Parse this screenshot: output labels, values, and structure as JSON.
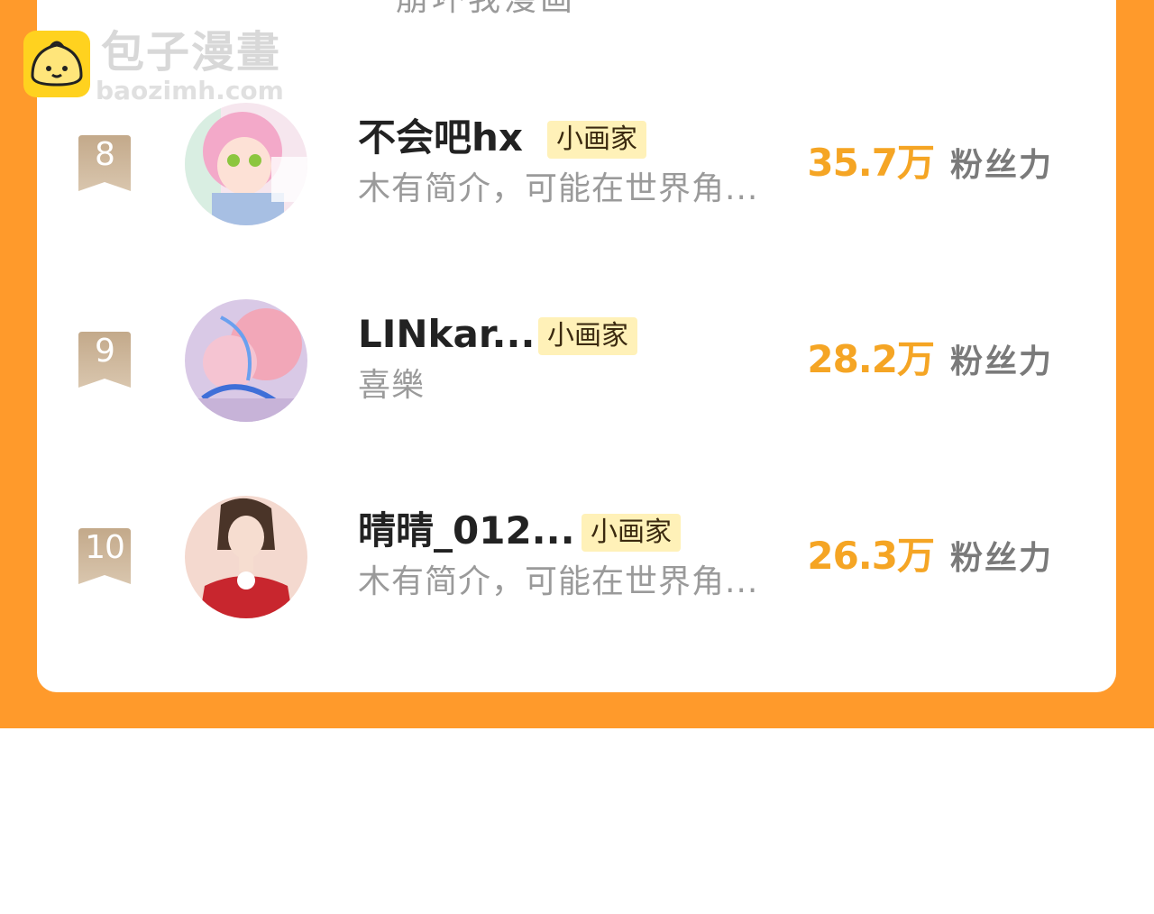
{
  "watermark": {
    "title": "包子漫畫",
    "url": "baozimh.com"
  },
  "top_partial_text": "崩坏我漫画",
  "ranking": [
    {
      "rank": "8",
      "name": "不会吧hx",
      "tag": "小画家",
      "bio": "木有简介，可能在世界角...",
      "fans_value": "35.7万",
      "fans_label": "粉丝力"
    },
    {
      "rank": "9",
      "name": "LINkar...",
      "tag": "小画家",
      "bio": "喜樂",
      "fans_value": "28.2万",
      "fans_label": "粉丝力"
    },
    {
      "rank": "10",
      "name": "晴晴_012...",
      "tag": "小画家",
      "bio": "木有简介，可能在世界角...",
      "fans_value": "26.3万",
      "fans_label": "粉丝力"
    }
  ],
  "colors": {
    "brand_orange": "#FF9A2B",
    "fans_number": "#F5A524",
    "tag_background": "#FFF1B8",
    "rank_badge": "#C9B08F"
  },
  "icons": {
    "rank_badge": "ribbon-bookmark-icon",
    "watermark_logo": "baozi-bun-logo-icon"
  }
}
